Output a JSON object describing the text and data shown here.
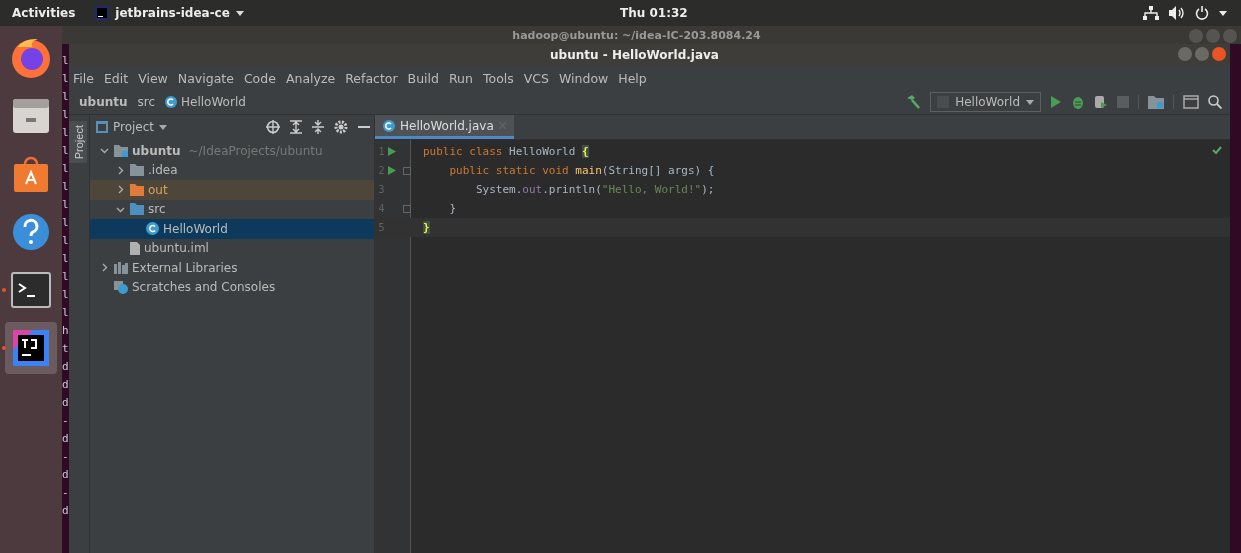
{
  "top_bar": {
    "activities": "Activities",
    "app_menu": "jetbrains-idea-ce",
    "clock": "Thu 01:32"
  },
  "dock": [
    {
      "kind": "browser",
      "running": false,
      "selected": false
    },
    {
      "kind": "files",
      "running": false,
      "selected": false
    },
    {
      "kind": "store",
      "running": false,
      "selected": false
    },
    {
      "kind": "help",
      "running": false,
      "selected": false
    },
    {
      "kind": "terminal",
      "running": true,
      "selected": false
    },
    {
      "kind": "idea",
      "running": true,
      "selected": true
    }
  ],
  "background_terminal": {
    "title": "hadoop@ubuntu: ~/idea-IC-203.8084.24",
    "lines": [
      "l",
      "l",
      "l",
      "l",
      "l",
      "l",
      "l",
      "l",
      "l",
      "l",
      "l",
      "l",
      "l",
      "l",
      "l",
      "h",
      "t",
      "d",
      "d",
      "d",
      "-",
      "d",
      "-",
      "d",
      "-",
      "d"
    ]
  },
  "window": {
    "title": "ubuntu - HelloWorld.java"
  },
  "menu": [
    "File",
    "Edit",
    "View",
    "Navigate",
    "Code",
    "Analyze",
    "Refactor",
    "Build",
    "Run",
    "Tools",
    "VCS",
    "Window",
    "Help"
  ],
  "breadcrumb": [
    {
      "label": "ubuntu",
      "kind": "module"
    },
    {
      "label": "src",
      "kind": "folder"
    },
    {
      "label": "HelloWorld",
      "kind": "class"
    }
  ],
  "run_config": "HelloWorld",
  "project_panel": {
    "side_tab": "Project",
    "title": "Project",
    "tree": [
      {
        "name": "ubuntu",
        "hint": "~/IdeaProjects/ubuntu",
        "kind": "module",
        "expanded": true,
        "selected": false,
        "children": [
          {
            "name": ".idea",
            "kind": "folder",
            "expanded": false,
            "selected": false
          },
          {
            "name": "out",
            "kind": "excluded",
            "expanded": false,
            "selected": false
          },
          {
            "name": "src",
            "kind": "source",
            "expanded": true,
            "selected": false,
            "children": [
              {
                "name": "HelloWorld",
                "kind": "class",
                "selected": true
              }
            ]
          },
          {
            "name": "ubuntu.iml",
            "kind": "file",
            "selected": false
          }
        ]
      },
      {
        "name": "External Libraries",
        "kind": "library",
        "expanded": false,
        "selected": false
      },
      {
        "name": "Scratches and Consoles",
        "kind": "scratch",
        "selected": false
      }
    ]
  },
  "editor": {
    "tabs": [
      {
        "label": "HelloWorld.java",
        "selected": true
      }
    ],
    "lines": [
      {
        "number": "1",
        "runnable": true,
        "fold": false,
        "current": false,
        "tokens": [
          {
            "kind": "keyword",
            "text": "public class "
          },
          {
            "kind": "plain",
            "text": "HelloWorld "
          },
          {
            "kind": "match",
            "text": "{"
          }
        ]
      },
      {
        "number": "2",
        "runnable": true,
        "fold": true,
        "current": false,
        "tokens": [
          {
            "kind": "keyword",
            "text": "    public static void "
          },
          {
            "kind": "method",
            "text": "main"
          },
          {
            "kind": "plain",
            "text": "(String[] args) {"
          }
        ]
      },
      {
        "number": "3",
        "runnable": false,
        "fold": false,
        "current": false,
        "tokens": [
          {
            "kind": "plain",
            "text": "        System."
          },
          {
            "kind": "field",
            "text": "out"
          },
          {
            "kind": "plain",
            "text": ".println("
          },
          {
            "kind": "string",
            "text": "\"Hello, World!\""
          },
          {
            "kind": "plain",
            "text": ");"
          }
        ]
      },
      {
        "number": "4",
        "runnable": false,
        "fold": true,
        "current": false,
        "tokens": [
          {
            "kind": "plain",
            "text": "    }"
          }
        ]
      },
      {
        "number": "5",
        "runnable": false,
        "fold": false,
        "current": true,
        "tokens": [
          {
            "kind": "match",
            "text": "}"
          }
        ]
      }
    ]
  }
}
